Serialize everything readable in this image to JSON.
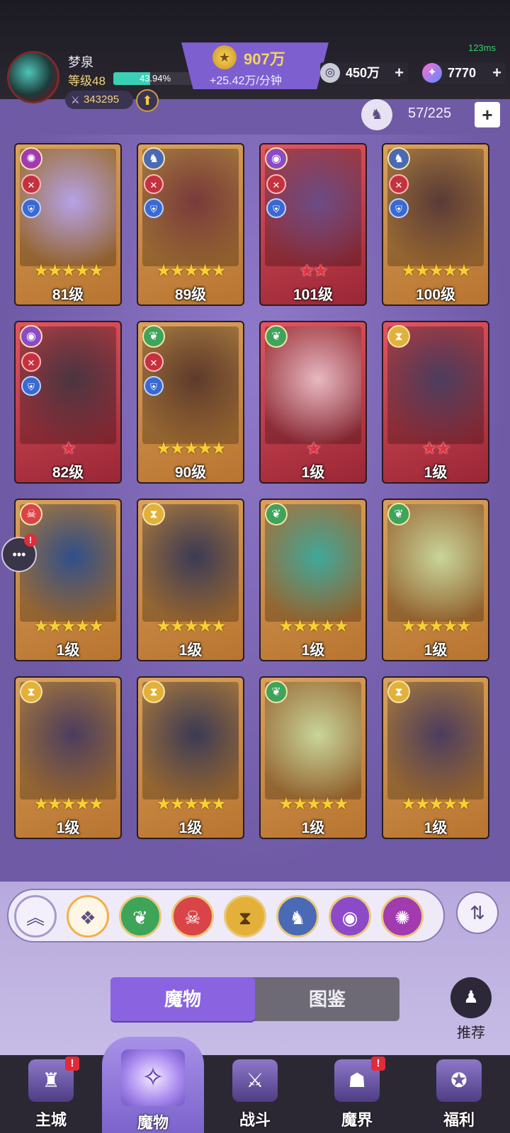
{
  "status": {
    "ping": "123ms"
  },
  "player": {
    "name": "梦泉",
    "level_label": "等级48",
    "xp_percent_label": "43.94%",
    "xp_fraction": 0.4394,
    "power": "343295",
    "power_icon": "sword-icon",
    "upgrade_icon": "arrow-up-icon"
  },
  "resources": {
    "gold_amount": "907万",
    "gold_rate": "+25.42万/分钟",
    "gold_icon": "coin-icon",
    "silver_amount": "450万",
    "gems_amount": "7770",
    "plus": "+"
  },
  "capacity": {
    "value": "57/225",
    "plus": "+"
  },
  "cards": [
    {
      "level": "81级",
      "stars": "★★★★★",
      "frame": "gold",
      "star_color": "gold",
      "element": "spiral",
      "art": "#b6a2e8",
      "roles": true
    },
    {
      "level": "89级",
      "stars": "★★★★★",
      "frame": "gold",
      "star_color": "gold",
      "element": "dragon",
      "art": "#7a3a3a",
      "roles": true
    },
    {
      "level": "101级",
      "stars": "★★",
      "frame": "red",
      "star_color": "red",
      "element": "eye",
      "art": "#6b4c86",
      "roles": true
    },
    {
      "level": "100级",
      "stars": "★★★★★",
      "frame": "gold",
      "star_color": "gold",
      "element": "dragon",
      "art": "#5a3a36",
      "roles": true
    },
    {
      "level": "82级",
      "stars": "★",
      "frame": "red",
      "star_color": "red",
      "element": "eye",
      "art": "#4b3540",
      "roles": true
    },
    {
      "level": "90级",
      "stars": "★★★★★",
      "frame": "gold",
      "star_color": "gold",
      "element": "nature",
      "art": "#5e3a2a",
      "roles": true
    },
    {
      "level": "1级",
      "stars": "★",
      "frame": "red",
      "star_color": "red",
      "element": "nature",
      "art": "#e8b9c2",
      "roles": false
    },
    {
      "level": "1级",
      "stars": "★★",
      "frame": "red",
      "star_color": "red",
      "element": "time",
      "art": "#4c3d5e",
      "roles": false
    },
    {
      "level": "1级",
      "stars": "★★★★★",
      "frame": "gold",
      "star_color": "gold",
      "element": "demon",
      "art": "#2f4f8a",
      "roles": false
    },
    {
      "level": "1级",
      "stars": "★★★★★",
      "frame": "gold",
      "star_color": "gold",
      "element": "time",
      "art": "#3b3a55",
      "roles": false
    },
    {
      "level": "1级",
      "stars": "★★★★★",
      "frame": "gold",
      "star_color": "gold",
      "element": "nature",
      "art": "#3fa89a",
      "roles": false
    },
    {
      "level": "1级",
      "stars": "★★★★★",
      "frame": "gold",
      "star_color": "gold",
      "element": "nature",
      "art": "#c9d59a",
      "roles": false
    },
    {
      "level": "1级",
      "stars": "★★★★★",
      "frame": "gold",
      "star_color": "gold",
      "element": "time",
      "art": "#4c3d5e",
      "roles": false
    },
    {
      "level": "1级",
      "stars": "★★★★★",
      "frame": "gold",
      "star_color": "gold",
      "element": "time",
      "art": "#3b3a55",
      "roles": false
    },
    {
      "level": "1级",
      "stars": "★★★★★",
      "frame": "gold",
      "star_color": "gold",
      "element": "nature",
      "art": "#c9d59a",
      "roles": false
    },
    {
      "level": "1级",
      "stars": "★★★★★",
      "frame": "gold",
      "star_color": "gold",
      "element": "time",
      "art": "#4c3d5e",
      "roles": false
    }
  ],
  "element_colors": {
    "spiral": "#a23ab0",
    "dragon": "#4b6ab5",
    "eye": "#8d4ac8",
    "nature": "#3ea45a",
    "time": "#e3b13a",
    "demon": "#d94448"
  },
  "filters": [
    {
      "name": "filter-collapse",
      "icon": "chevrons-up-icon"
    },
    {
      "name": "filter-all",
      "icon": "diamond-grid-icon"
    },
    {
      "name": "filter-nature",
      "icon": "leaf-icon"
    },
    {
      "name": "filter-demon",
      "icon": "demon-mask-icon"
    },
    {
      "name": "filter-time",
      "icon": "hourglass-icon"
    },
    {
      "name": "filter-dragon",
      "icon": "dragon-icon"
    },
    {
      "name": "filter-eye",
      "icon": "eye-icon"
    },
    {
      "name": "filter-spiral",
      "icon": "spiral-icon"
    }
  ],
  "tabs": {
    "monsters": "魔物",
    "codex": "图鉴"
  },
  "recommend": {
    "label": "推荐"
  },
  "nav": [
    {
      "label": "主城",
      "icon": "castle-icon",
      "badge": "!"
    },
    {
      "label": "魔物",
      "icon": "monster-flame-icon",
      "badge": ""
    },
    {
      "label": "战斗",
      "icon": "sword-shield-icon",
      "badge": ""
    },
    {
      "label": "魔界",
      "icon": "demon-realm-icon",
      "badge": "!"
    },
    {
      "label": "福利",
      "icon": "treasure-chest-icon",
      "badge": ""
    }
  ],
  "chat": {
    "badge": "!"
  }
}
